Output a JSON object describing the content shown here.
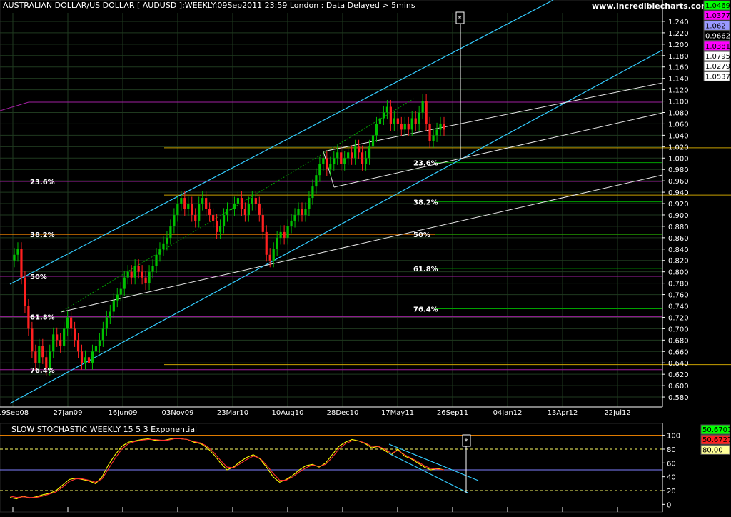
{
  "colors": {
    "background": "#000000",
    "grid": "#1f3a1f",
    "up_candle": "#00c000",
    "down_candle": "#ff2020",
    "channel": "#33ccff",
    "trend": "#e6e6e6",
    "fib_purple": "#a020a0",
    "fib_gold": "#c8a000",
    "fib_green": "#00a000",
    "stoch_k": "#ffff00",
    "stoch_d": "#ff3030",
    "stoch_band": "#ffff66"
  },
  "header": {
    "title": "AUSTRALIAN DOLLAR/US DOLLAR [ AUDUSD ]:WEEKLY:09Sep2011 23:59 London : Data Delayed > 5mins",
    "site": "www.incrediblecharts.com"
  },
  "price_boxes": [
    {
      "value": "1.0469",
      "bg": "#00ff00",
      "fg": "#000000"
    },
    {
      "value": "1.0377",
      "bg": "#ff00ff",
      "fg": "#000000"
    },
    {
      "value": "1.062",
      "bg": "#9999ff",
      "fg": "#000000"
    },
    {
      "value": "0.9662",
      "bg": "#000000",
      "fg": "#ffffff"
    },
    {
      "value": "1.0381",
      "bg": "#ff00ff",
      "fg": "#000000"
    },
    {
      "value": "1.0795",
      "bg": "#ffffff",
      "fg": "#000000"
    },
    {
      "value": "1.0279",
      "bg": "#ffffff",
      "fg": "#000000"
    },
    {
      "value": "1.0537",
      "bg": "#ffffff",
      "fg": "#000000"
    }
  ],
  "stoch_boxes": [
    {
      "value": "50.6701",
      "bg": "#00ff00",
      "fg": "#000000"
    },
    {
      "value": "50.6727",
      "bg": "#ff2020",
      "fg": "#000000"
    },
    {
      "value": "80.00",
      "bg": "#ffff99",
      "fg": "#000000"
    }
  ],
  "marker": "*",
  "chart_data": [
    {
      "type": "candlestick",
      "title": "AUSTRALIAN DOLLAR/US DOLLAR [ AUDUSD ]:WEEKLY:09Sep2011 23:59 London : Data Delayed > 5mins",
      "x_ticks": [
        "19Sep08",
        "27Jan09",
        "16Jun09",
        "03Nov09",
        "23Mar10",
        "10Aug10",
        "28Dec10",
        "17May11",
        "26Sep11",
        "04Jan12",
        "13Apr12",
        "22Jul12"
      ],
      "y_ticks": [
        "0.580",
        "0.600",
        "0.620",
        "0.640",
        "0.660",
        "0.680",
        "0.700",
        "0.720",
        "0.740",
        "0.760",
        "0.780",
        "0.800",
        "0.820",
        "0.840",
        "0.860",
        "0.880",
        "0.900",
        "0.920",
        "0.940",
        "0.960",
        "0.980",
        "1.000",
        "1.020",
        "1.040",
        "1.060",
        "1.080",
        "1.100",
        "1.120",
        "1.140",
        "1.160",
        "1.180",
        "1.200",
        "1.220",
        "1.240"
      ],
      "ylim": [
        0.565,
        1.255
      ],
      "grid": true,
      "close_series": [
        0.83,
        0.84,
        0.79,
        0.74,
        0.7,
        0.66,
        0.64,
        0.67,
        0.65,
        0.63,
        0.66,
        0.69,
        0.68,
        0.67,
        0.7,
        0.72,
        0.7,
        0.68,
        0.66,
        0.64,
        0.65,
        0.64,
        0.66,
        0.67,
        0.68,
        0.7,
        0.72,
        0.73,
        0.75,
        0.76,
        0.77,
        0.79,
        0.8,
        0.79,
        0.81,
        0.8,
        0.79,
        0.78,
        0.8,
        0.81,
        0.83,
        0.84,
        0.85,
        0.86,
        0.88,
        0.9,
        0.92,
        0.93,
        0.91,
        0.92,
        0.9,
        0.89,
        0.92,
        0.93,
        0.91,
        0.9,
        0.89,
        0.87,
        0.88,
        0.9,
        0.91,
        0.91,
        0.92,
        0.93,
        0.91,
        0.9,
        0.92,
        0.93,
        0.92,
        0.9,
        0.87,
        0.83,
        0.82,
        0.84,
        0.86,
        0.87,
        0.86,
        0.88,
        0.89,
        0.9,
        0.91,
        0.9,
        0.91,
        0.93,
        0.95,
        0.97,
        0.99,
        1.0,
        0.98,
        0.99,
        1.0,
        1.01,
        0.99,
        1.0,
        1.01,
        1.0,
        1.02,
        1.01,
        0.99,
        1.0,
        1.02,
        1.04,
        1.06,
        1.07,
        1.08,
        1.09,
        1.06,
        1.07,
        1.06,
        1.05,
        1.06,
        1.05,
        1.07,
        1.06,
        1.08,
        1.1,
        1.06,
        1.03,
        1.04,
        1.05,
        1.06,
        1.05
      ],
      "fib_levels": [
        {
          "label": "23.6%",
          "value": 0.959,
          "color": "#a020a0",
          "side": "left"
        },
        {
          "label": "38.2%",
          "value": 0.866,
          "color": "#ff8c00",
          "side": "left"
        },
        {
          "label": "50%",
          "value": 0.792,
          "color": "#a020a0",
          "side": "left"
        },
        {
          "label": "61.8%",
          "value": 0.721,
          "color": "#a020a0",
          "side": "left"
        },
        {
          "label": "76.4%",
          "value": 0.628,
          "color": "#a020a0",
          "side": "left"
        },
        {
          "label": "23.6%",
          "value": 0.992,
          "color": "#00a000",
          "side": "right"
        },
        {
          "label": "38.2%",
          "value": 0.923,
          "color": "#00a000",
          "side": "right"
        },
        {
          "label": "50%",
          "value": 0.866,
          "color": "#00a000",
          "side": "right"
        },
        {
          "label": "61.8%",
          "value": 0.806,
          "color": "#00a000",
          "side": "right"
        },
        {
          "label": "76.4%",
          "value": 0.735,
          "color": "#00a000",
          "side": "right"
        }
      ]
    },
    {
      "type": "line",
      "title": "SLOW STOCHASTIC WEEKLY 15 5 3 Exponential",
      "y_ticks": [
        "0",
        "20",
        "40",
        "60",
        "80",
        "100"
      ],
      "ylim": [
        -10,
        110
      ],
      "bands": [
        20,
        80
      ],
      "series": [
        {
          "values": [
            10,
            8,
            12,
            9,
            11,
            14,
            16,
            20,
            28,
            36,
            38,
            36,
            34,
            30,
            40,
            58,
            72,
            84,
            90,
            92,
            94,
            95,
            93,
            92,
            94,
            96,
            95,
            94,
            90,
            88,
            82,
            72,
            60,
            50,
            54,
            62,
            68,
            72,
            66,
            54,
            40,
            32,
            36,
            42,
            50,
            56,
            58,
            54,
            60,
            72,
            84,
            90,
            94,
            92,
            88,
            82,
            84,
            78,
            72,
            80,
            70,
            66,
            60,
            54,
            50,
            52,
            50
          ]
        },
        {
          "values": [
            12,
            10,
            11,
            10,
            10,
            12,
            15,
            18,
            25,
            33,
            37,
            37,
            35,
            32,
            37,
            52,
            67,
            80,
            88,
            91,
            93,
            94,
            94,
            93,
            93,
            95,
            95,
            94,
            91,
            89,
            84,
            75,
            64,
            54,
            53,
            59,
            65,
            70,
            67,
            57,
            45,
            35,
            35,
            40,
            47,
            53,
            57,
            55,
            58,
            68,
            80,
            88,
            92,
            92,
            89,
            84,
            84,
            80,
            74,
            78,
            72,
            67,
            62,
            56,
            52,
            51,
            50
          ]
        }
      ]
    }
  ]
}
